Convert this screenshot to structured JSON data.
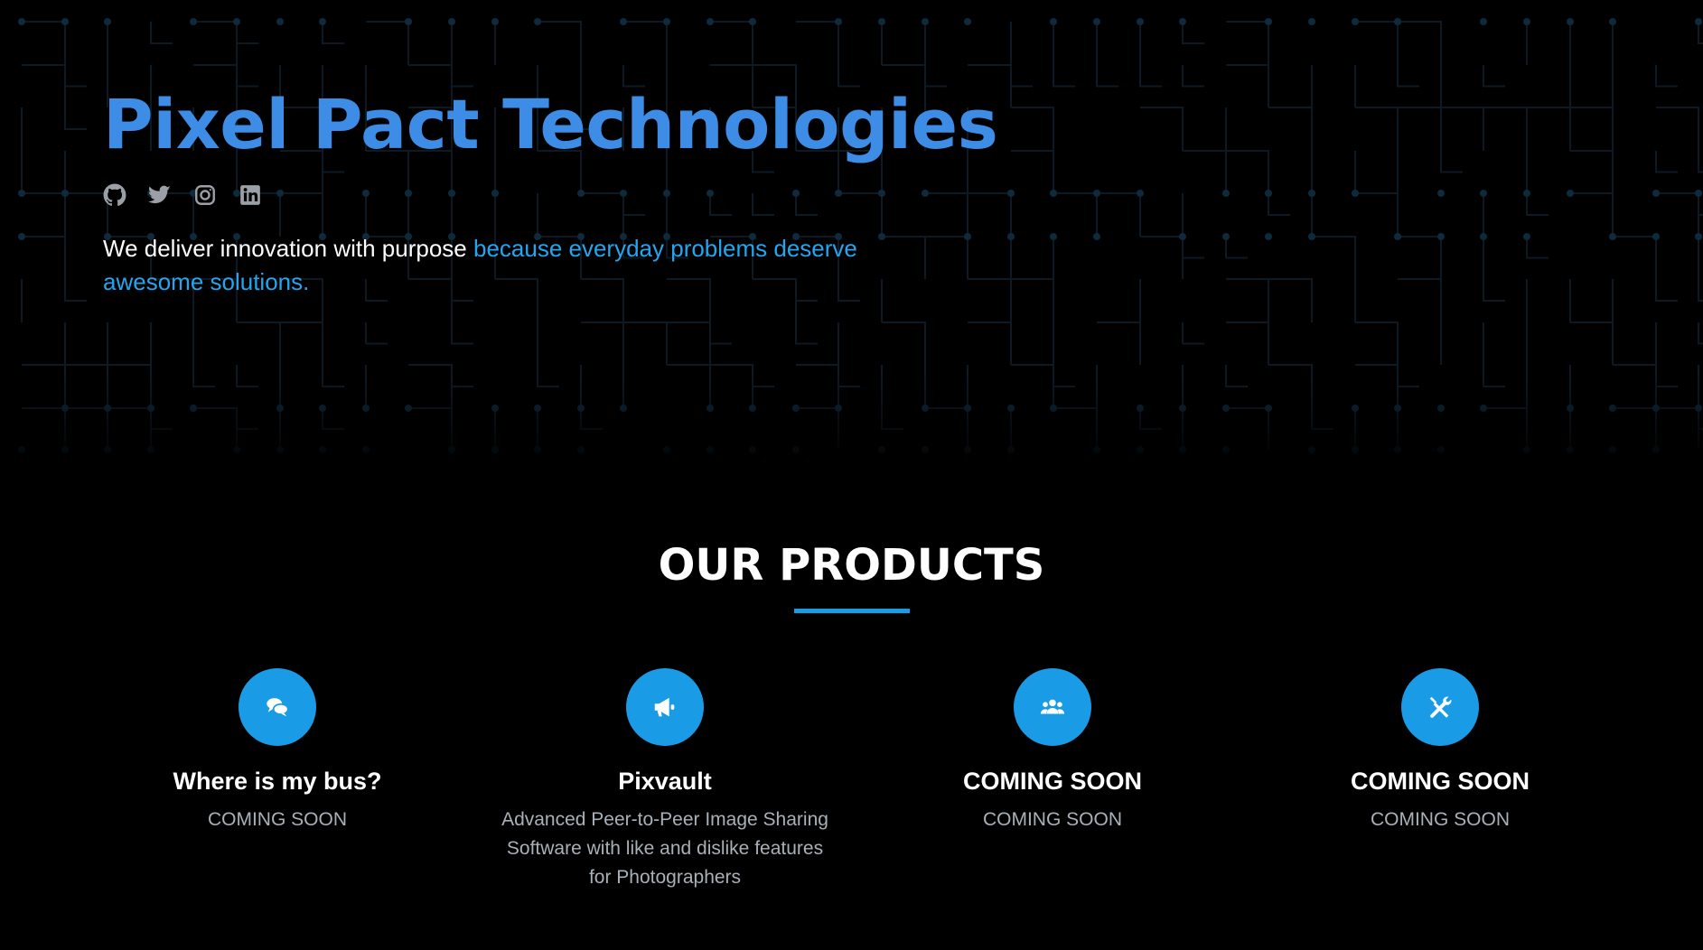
{
  "hero": {
    "title": "Pixel Pact Technologies",
    "tagline_plain": "We deliver innovation with purpose ",
    "tagline_accent": "because everyday problems deserve awesome solutions.",
    "socials": [
      {
        "name": "github-icon"
      },
      {
        "name": "twitter-icon"
      },
      {
        "name": "instagram-icon"
      },
      {
        "name": "linkedin-icon"
      }
    ]
  },
  "products": {
    "heading": "OUR PRODUCTS",
    "items": [
      {
        "icon": "chat-bubbles-icon",
        "title": "Where is my bus?",
        "description": "COMING SOON"
      },
      {
        "icon": "megaphone-icon",
        "title": "Pixvault",
        "description": "Advanced Peer-to-Peer Image Sharing Software with like and dislike features for Photographers"
      },
      {
        "icon": "users-icon",
        "title": "COMING SOON",
        "description": "COMING SOON"
      },
      {
        "icon": "tools-icon",
        "title": "COMING SOON",
        "description": "COMING SOON"
      }
    ]
  },
  "colors": {
    "background": "#000000",
    "brand": "#3d8ce6",
    "accent": "#23a6f0",
    "icon_circle": "#1a9be6",
    "muted_text": "#a8b0b8"
  }
}
